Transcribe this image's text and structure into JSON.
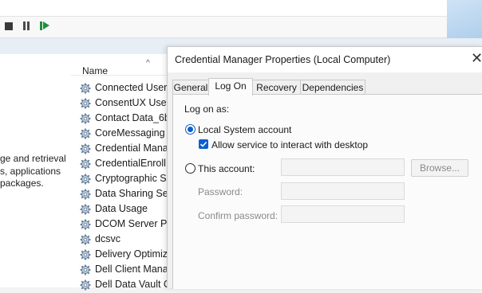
{
  "background": {
    "name_column": "Name",
    "description_lines": "ge and retrieval\ns, applications\npackages.",
    "services": [
      "Connected User E",
      "ConsentUX User S",
      "Contact Data_6bf",
      "CoreMessaging",
      "Credential Manag",
      "CredentialEnrollI",
      "Cryptographic Se",
      "Data Sharing Serv",
      "Data Usage",
      "DCOM Server Pro",
      "dcsvc",
      "Delivery Optimiza",
      "Dell Client Manag",
      "Dell Data Vault Co"
    ]
  },
  "dialog": {
    "title": "Credential Manager Properties (Local Computer)",
    "close_glyph": "✕",
    "tabs": [
      "General",
      "Log On",
      "Recovery",
      "Dependencies"
    ],
    "active_tab": "Log On",
    "logon_as": "Log on as:",
    "local_system": "Local System account",
    "allow_interact": "Allow service to interact with desktop",
    "this_account": "This account:",
    "browse": "Browse...",
    "password": "Password:",
    "confirm_password": "Confirm password:"
  },
  "colors": {
    "accent": "#0b5fd0",
    "restart_green": "#1e8e3e"
  }
}
